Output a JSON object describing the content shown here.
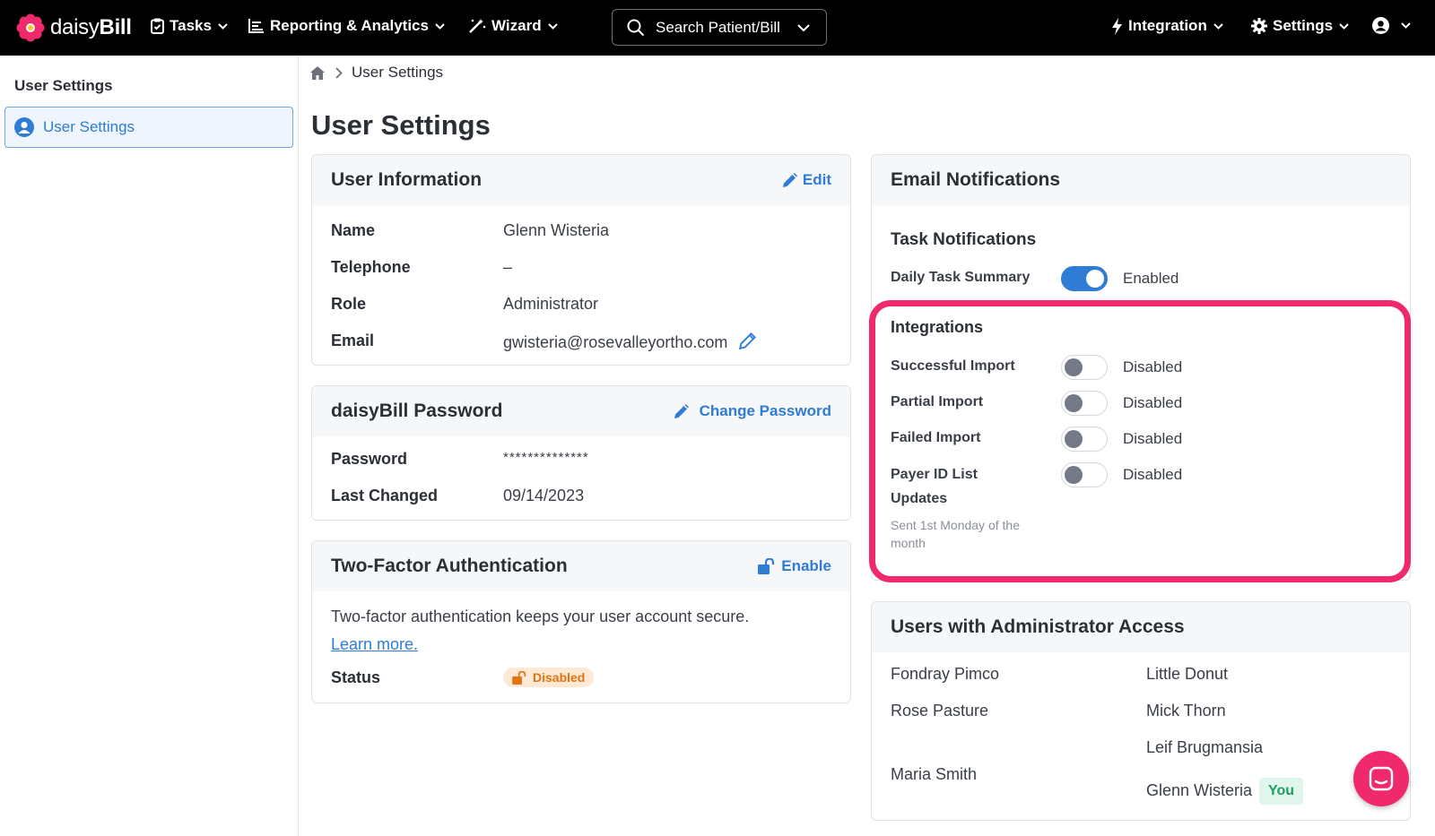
{
  "nav": {
    "logo_light": "daisy",
    "logo_bold": "Bill",
    "tasks": "Tasks",
    "reporting": "Reporting & Analytics",
    "wizard": "Wizard",
    "search_placeholder": "Search Patient/Bill",
    "integration": "Integration",
    "settings": "Settings"
  },
  "sidebar": {
    "title": "User Settings",
    "items": [
      {
        "label": "User Settings"
      }
    ]
  },
  "breadcrumb": {
    "current": "User Settings"
  },
  "page_title": "User Settings",
  "user_info": {
    "title": "User Information",
    "edit": "Edit",
    "rows": [
      {
        "label": "Name",
        "value": "Glenn Wisteria"
      },
      {
        "label": "Telephone",
        "value": "–"
      },
      {
        "label": "Role",
        "value": "Administrator"
      },
      {
        "label": "Email",
        "value": "gwisteria@rosevalleyortho.com"
      }
    ]
  },
  "password": {
    "title": "daisyBill Password",
    "change": "Change Password",
    "rows": [
      {
        "label": "Password",
        "value": "**************"
      },
      {
        "label": "Last Changed",
        "value": "09/14/2023"
      }
    ]
  },
  "tfa": {
    "title": "Two-Factor Authentication",
    "enable": "Enable",
    "description": "Two-factor authentication keeps your user account secure.",
    "learn_more": "Learn more.",
    "status_label": "Status",
    "status_value": "Disabled"
  },
  "email_notifications": {
    "title": "Email Notifications",
    "task_title": "Task Notifications",
    "task_items": [
      {
        "label": "Daily Task Summary",
        "state": "Enabled",
        "on": true
      }
    ],
    "integrations_title": "Integrations",
    "integration_items": [
      {
        "label": "Successful Import",
        "state": "Disabled",
        "on": false
      },
      {
        "label": "Partial Import",
        "state": "Disabled",
        "on": false
      },
      {
        "label": "Failed Import",
        "state": "Disabled",
        "on": false
      },
      {
        "label_line1": "Payer ID List",
        "label_line2": "Updates",
        "state": "Disabled",
        "on": false,
        "hint": "Sent 1st Monday of the month"
      }
    ]
  },
  "admins": {
    "title": "Users with Administrator Access",
    "left": [
      "Fondray Pimco",
      "Rose Pasture",
      "Maria Smith"
    ],
    "right": [
      "Little Donut",
      "Mick Thorn",
      "Leif Brugmansia",
      "Glenn Wisteria"
    ],
    "you_label": "You"
  },
  "colors": {
    "accent": "#2e7cd6",
    "highlight": "#f0286c",
    "warning": "#e2740f"
  }
}
